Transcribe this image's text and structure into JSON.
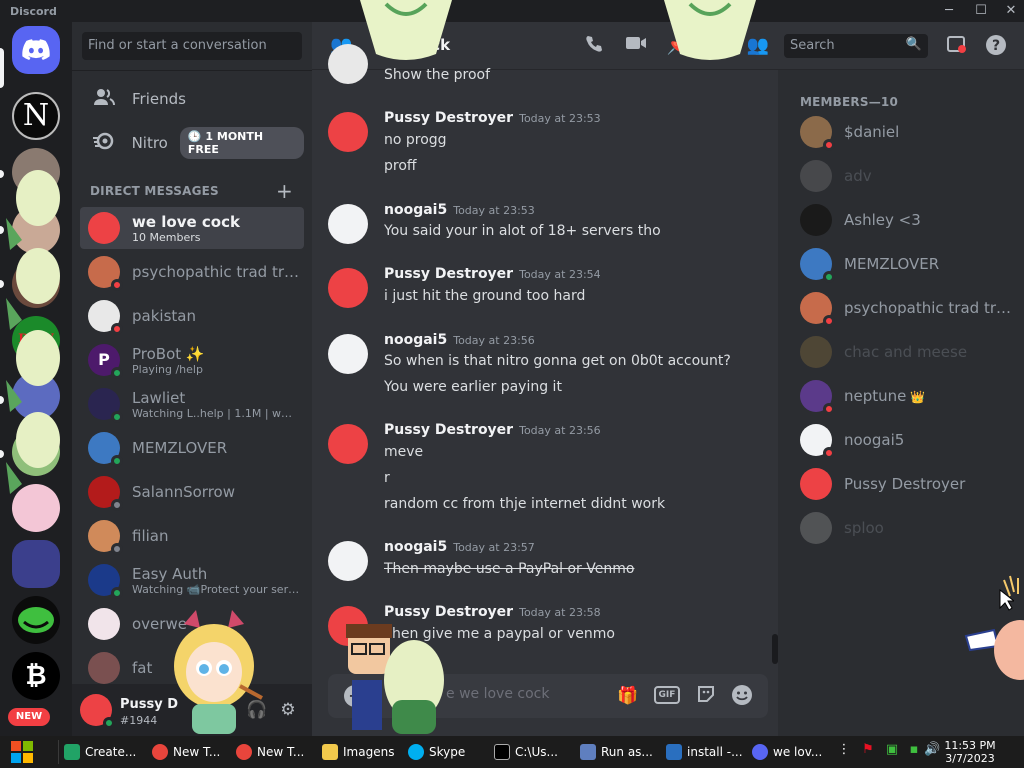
{
  "app": {
    "title": "Discord"
  },
  "colors": {
    "blurple": "#5865f2",
    "online": "#23a55a",
    "dnd": "#f23f43",
    "idle": "#f0b232",
    "offline": "#80848e"
  },
  "servers": {
    "new_label": "NEW"
  },
  "sidebar": {
    "search_placeholder": "Find or start a conversation",
    "friends_label": "Friends",
    "nitro_label": "Nitro",
    "nitro_badge": "1 MONTH FREE",
    "dm_header": "DIRECT MESSAGES",
    "dms": [
      {
        "name": "we love cock",
        "sub": "10 Members",
        "active": true
      },
      {
        "name": "psychopathic trad tra...",
        "sub": ""
      },
      {
        "name": "pakistan",
        "sub": ""
      },
      {
        "name": "ProBot ✨",
        "sub": "Playing /help"
      },
      {
        "name": "Lawliet",
        "sub": "Watching L..help | 1.1M | www.l..."
      },
      {
        "name": "MEMZLOVER",
        "sub": ""
      },
      {
        "name": "SalannSorrow",
        "sub": ""
      },
      {
        "name": "filian",
        "sub": ""
      },
      {
        "name": "Easy Auth",
        "sub": "Watching 📹Protect your serv..."
      },
      {
        "name": "overwe",
        "sub": ""
      },
      {
        "name": "fat",
        "sub": ""
      }
    ]
  },
  "user": {
    "name": "Pussy D",
    "tag": "#1944"
  },
  "channel": {
    "name": "cock",
    "search_placeholder": "Search"
  },
  "messages": {
    "m0": {
      "lines": [
        "Show the proof"
      ]
    },
    "m1": {
      "author": "Pussy Destroyer",
      "time": "Today at 23:53",
      "lines": [
        "no progg",
        "proff"
      ]
    },
    "m2": {
      "author": "noogai5",
      "time": "Today at 23:53",
      "lines": [
        "You said your in alot of 18+ servers tho"
      ]
    },
    "m3": {
      "author": "Pussy Destroyer",
      "time": "Today at 23:54",
      "lines": [
        "i just hit the ground too hard"
      ]
    },
    "m4": {
      "author": "noogai5",
      "time": "Today at 23:56",
      "lines": [
        "So when is that nitro gonna get on 0b0t account?",
        "You were earlier paying it"
      ]
    },
    "m5": {
      "author": "Pussy Destroyer",
      "time": "Today at 23:56",
      "lines": [
        "meve",
        "r",
        "random cc from thje internet didnt work"
      ]
    },
    "m6": {
      "author": "noogai5",
      "time": "Today at 23:57",
      "lines": [
        "Then maybe use a PayPal or Venmo"
      ]
    },
    "m7": {
      "author": "Pussy Destroyer",
      "time": "Today at 23:58",
      "lines": [
        "hen give me a paypal or venmo"
      ]
    }
  },
  "composer": {
    "placeholder": "e we love cock",
    "gif_label": "GIF"
  },
  "members": {
    "header": "MEMBERS—10",
    "list": [
      {
        "name": "$daniel",
        "status": "dnd"
      },
      {
        "name": "adv",
        "status": "offline"
      },
      {
        "name": "Ashley <3",
        "status": "none"
      },
      {
        "name": "MEMZLOVER",
        "status": "online"
      },
      {
        "name": "psychopathic trad tra...",
        "status": "dnd"
      },
      {
        "name": "chac and meese",
        "status": "offline"
      },
      {
        "name": "neptune",
        "status": "dnd",
        "crown": "👑"
      },
      {
        "name": "noogai5",
        "status": "dnd"
      },
      {
        "name": "Pussy Destroyer",
        "status": "none"
      },
      {
        "name": "sploo",
        "status": "offline"
      }
    ]
  },
  "taskbar": {
    "items": [
      "Create...",
      "New T...",
      "New T...",
      "Imagens",
      "Skype",
      "C:\\Us...",
      "Run as...",
      "install -...",
      "we lov..."
    ],
    "time": "11:53 PM",
    "date": "3/7/2023"
  }
}
